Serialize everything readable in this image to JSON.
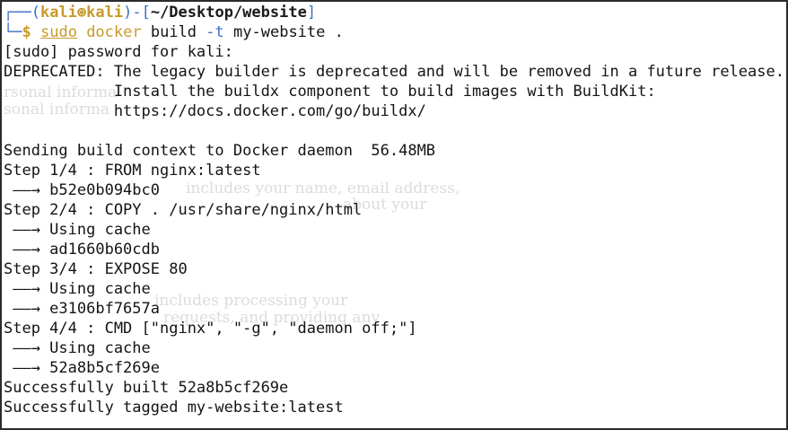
{
  "prompt": {
    "box_top_left": "┌──(",
    "user": "kali",
    "at_glyph": "⊛",
    "host": "kali",
    "mid": ")-[",
    "cwd": "~/Desktop/website",
    "close": "]",
    "box_bottom_left": "└─",
    "dollar": "$",
    "cmd_sudo": "sudo",
    "cmd_docker": "docker",
    "cmd_build": "build",
    "cmd_flag": "-t",
    "cmd_args": "my-website ."
  },
  "output": [
    "[sudo] password for kali:",
    "DEPRECATED: The legacy builder is deprecated and will be removed in a future release.",
    "            Install the buildx component to build images with BuildKit:",
    "            https://docs.docker.com/go/buildx/",
    "",
    "Sending build context to Docker daemon  56.48MB",
    "Step 1/4 : FROM nginx:latest",
    " ——→ b52e0b094bc0",
    "Step 2/4 : COPY . /usr/share/nginx/html",
    " ——→ Using cache",
    " ——→ ad1660b60cdb",
    "Step 3/4 : EXPOSE 80",
    " ——→ Using cache",
    " ——→ e3106bf7657a",
    "Step 4/4 : CMD [\"nginx\", \"-g\", \"daemon off;\"]",
    " ——→ Using cache",
    " ——→ 52a8b5cf269e",
    "Successfully built 52a8b5cf269e",
    "Successfully tagged my-website:latest"
  ],
  "ghost_text": [
    "rsonal informa",
    "sonal informa",
    "includes your name, email address,",
    "about your",
    "includes processing your",
    "requests, and providing any"
  ],
  "colors": {
    "prompt_box": "#3d6fc7",
    "prompt_user": "#c79a2a",
    "command": "#c79a2a",
    "text": "#141414",
    "background": "#ffffff"
  }
}
